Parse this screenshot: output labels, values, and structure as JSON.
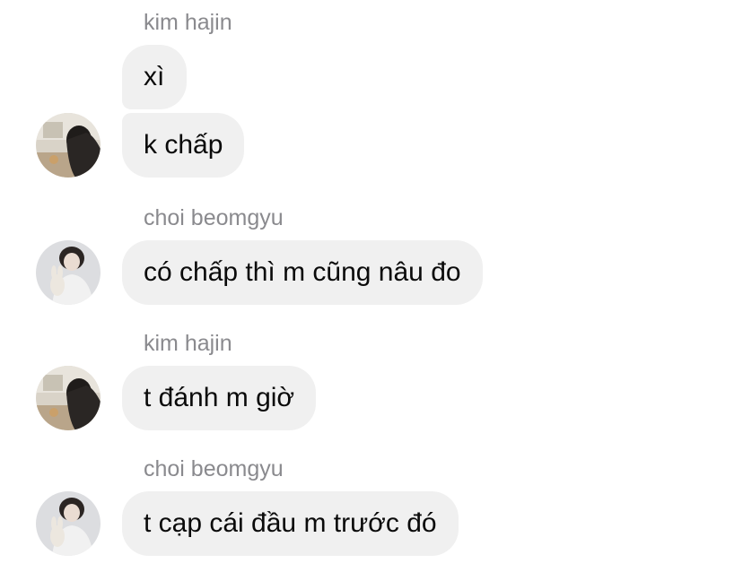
{
  "messages": [
    {
      "sender": "kim hajin",
      "lines": [
        "xì",
        "k chấp"
      ],
      "avatar": "kim-hajin-avatar"
    },
    {
      "sender": "choi beomgyu",
      "lines": [
        "có chấp thì m cũng nâu đo"
      ],
      "avatar": "choi-beomgyu-avatar"
    },
    {
      "sender": "kim hajin",
      "lines": [
        "t đánh m giờ"
      ],
      "avatar": "kim-hajin-avatar"
    },
    {
      "sender": "choi beomgyu",
      "lines": [
        "t cạp cái đầu m trước đó"
      ],
      "avatar": "choi-beomgyu-avatar"
    }
  ],
  "colors": {
    "bubble": "#f0f0f0",
    "sender_text": "#8a8a8e",
    "message_text": "#0a0a0a"
  }
}
